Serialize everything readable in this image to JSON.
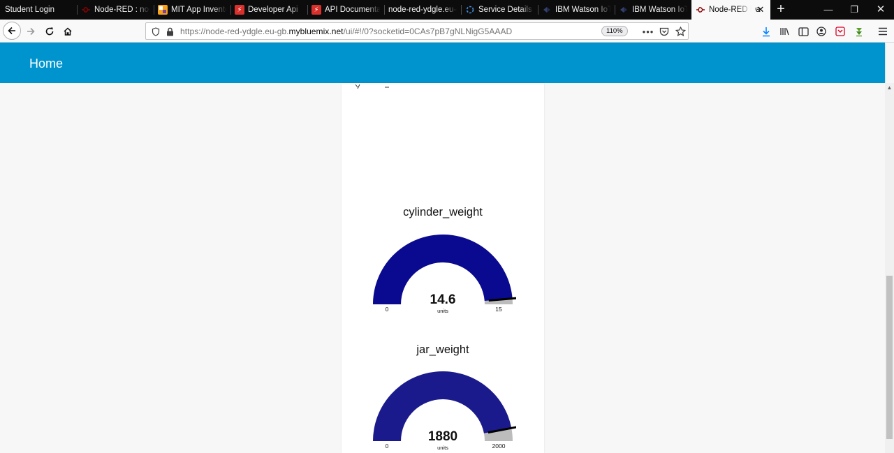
{
  "browser": {
    "tabs": [
      {
        "label": "Student Login",
        "icon": "blank-icon",
        "color": "",
        "active": false
      },
      {
        "label": "Node-RED : node",
        "icon": "node-red-icon",
        "color": "#8f0000",
        "active": false
      },
      {
        "label": "MIT App Inventor",
        "icon": "mit-app-inventor-icon",
        "color": "#f6a21b",
        "active": false
      },
      {
        "label": "Developer Api",
        "icon": "api-bolt-icon",
        "color": "#d9302c",
        "active": false
      },
      {
        "label": "API Documentati",
        "icon": "api-bolt-icon",
        "color": "#d9302c",
        "active": false
      },
      {
        "label": "node-red-ydgle.eu-g",
        "icon": "blank-icon",
        "color": "",
        "active": false
      },
      {
        "label": "Service Details",
        "icon": "loading-icon",
        "color": "#4a90e2",
        "active": false
      },
      {
        "label": "IBM Watson IoT P",
        "icon": "watson-icon",
        "color": "#1f2b4f",
        "active": false
      },
      {
        "label": "IBM Watson IoT P",
        "icon": "watson-icon",
        "color": "#1f2b4f",
        "active": false
      },
      {
        "label": "Node-RED Da",
        "icon": "node-red-icon",
        "color": "#8f0000",
        "active": true
      }
    ],
    "close_tab": "✕",
    "new_tab": "+",
    "url_prefix": "https://node-red-ydgle.eu-gb.",
    "url_domain": "mybluemix.net",
    "url_suffix": "/ui/#!/0?socketid=0CAs7pB7gNLNigG5AAAD",
    "zoom": "110%"
  },
  "dashboard": {
    "title": "Home",
    "gauges": [
      {
        "label": "cylinder_weight",
        "value": 14.6,
        "value_text": "14.6",
        "min": 0,
        "max": 15,
        "min_text": "0",
        "max_text": "15",
        "units": "units",
        "color": "#0a0a90"
      },
      {
        "label": "jar_weight",
        "value": 1880,
        "value_text": "1880",
        "min": 0,
        "max": 2000,
        "min_text": "0",
        "max_text": "2000",
        "units": "units",
        "color": "#1a1a8c"
      }
    ]
  }
}
